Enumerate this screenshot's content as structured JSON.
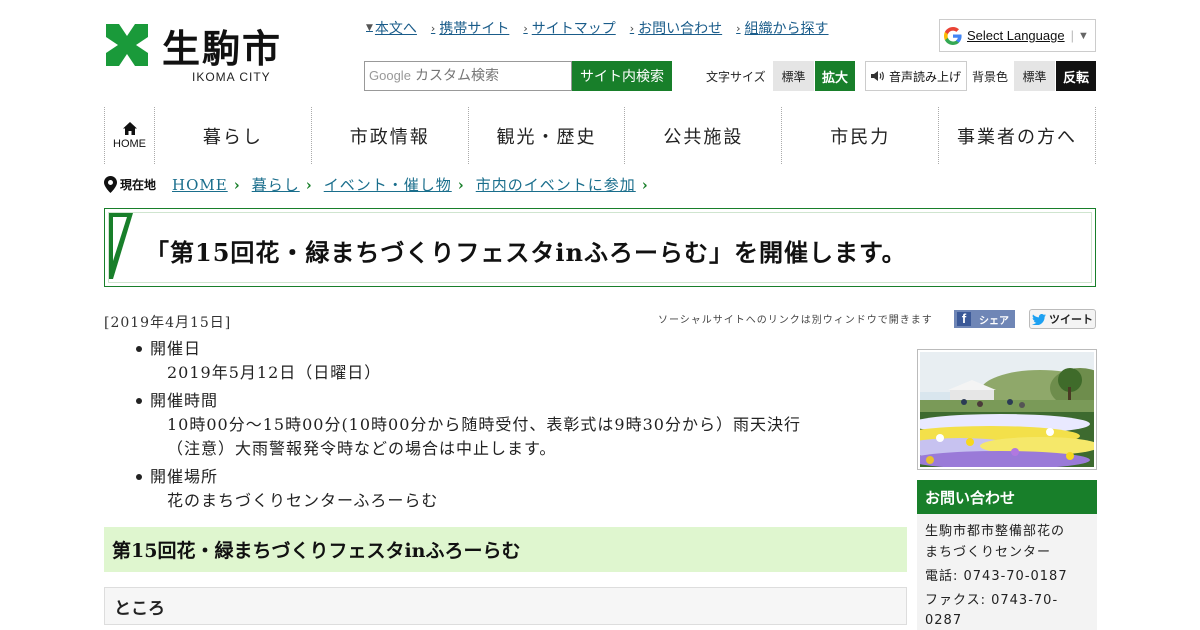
{
  "site": {
    "logo_text": "生駒市",
    "logo_sub": "IKOMA CITY"
  },
  "top_links": [
    "本文へ",
    "携帯サイト",
    "サイトマップ",
    "お問い合わせ",
    "組織から探す"
  ],
  "language": {
    "label": "Select Language"
  },
  "search": {
    "brand": "Google",
    "placeholder": "カスタム検索",
    "button": "サイト内検索"
  },
  "tools": {
    "font_size_label": "文字サイズ",
    "font_std": "標準",
    "font_big": "拡大",
    "voice": "音声読み上げ",
    "bg_label": "背景色",
    "bg_std": "標準",
    "bg_invert": "反転"
  },
  "nav": {
    "home": "HOME",
    "items": [
      "暮らし",
      "市政情報",
      "観光・歴史",
      "公共施設",
      "市民力",
      "事業者の方へ"
    ]
  },
  "breadcrumb": {
    "label": "現在地",
    "items": [
      "HOME",
      "暮らし",
      "イベント・催し物",
      "市内のイベントに参加"
    ]
  },
  "page": {
    "title": "「第15回花・緑まちづくりフェスタinふろーらむ」を開催します。",
    "date": "[2019年4月15日]",
    "social_note": "ソーシャルサイトへのリンクは別ウィンドウで開きます",
    "share_label": "シェア",
    "tweet_label": "ツイート"
  },
  "info": [
    {
      "title": "開催日",
      "lines": [
        "2019年5月12日（日曜日）"
      ]
    },
    {
      "title": "開催時間",
      "lines": [
        "10時00分～15時00分(10時00分から随時受付、表彰式は9時30分から）雨天決行",
        "（注意）大雨警報発令時などの場合は中止します。"
      ]
    },
    {
      "title": "開催場所",
      "lines": [
        "花のまちづくりセンターふろーらむ"
      ]
    }
  ],
  "section": {
    "heading": "第15回花・緑まちづくりフェスタinふろーらむ",
    "subheading": "ところ"
  },
  "contact": {
    "heading": "お問い合わせ",
    "org_line1": "生駒市都市整備部花の",
    "org_line2": "まちづくりセンター",
    "tel": "電話: 0743-70-0187",
    "fax_line1": "ファクス: 0743-70-",
    "fax_line2": "0287"
  },
  "colors": {
    "brand_green": "#187f2a",
    "link_blue": "#1a5c8a",
    "heading_bg": "#dff6cf"
  }
}
